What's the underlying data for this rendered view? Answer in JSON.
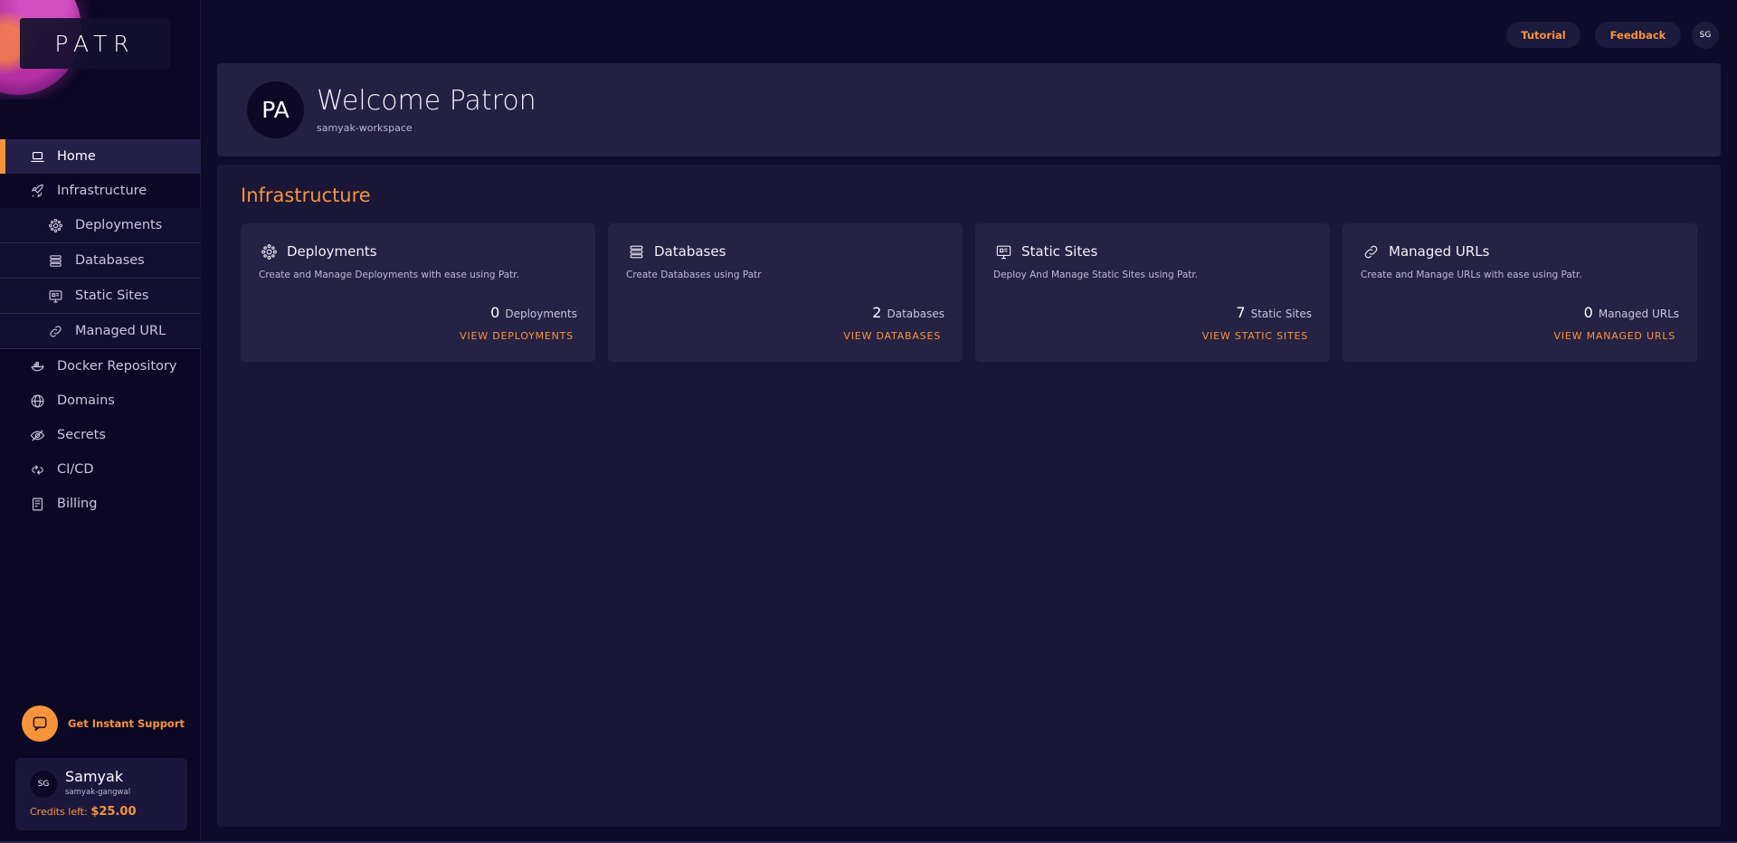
{
  "brand": {
    "logo_text": "PATR"
  },
  "sidebar": {
    "items": [
      {
        "label": "Home",
        "icon": "laptop-icon",
        "active": true
      },
      {
        "label": "Infrastructure",
        "icon": "rocket-icon"
      },
      {
        "label": "Deployments",
        "icon": "gear-cluster-icon",
        "sub": true
      },
      {
        "label": "Databases",
        "icon": "database-icon",
        "sub": true
      },
      {
        "label": "Static Sites",
        "icon": "monitor-icon",
        "sub": true
      },
      {
        "label": "Managed URL",
        "icon": "link-icon",
        "sub": true
      },
      {
        "label": "Docker Repository",
        "icon": "docker-icon"
      },
      {
        "label": "Domains",
        "icon": "globe-icon"
      },
      {
        "label": "Secrets",
        "icon": "eye-off-icon"
      },
      {
        "label": "CI/CD",
        "icon": "cicd-icon"
      },
      {
        "label": "Billing",
        "icon": "billing-icon"
      }
    ],
    "support_label": "Get Instant Support",
    "user": {
      "initials": "SG",
      "name": "Samyak",
      "handle": "samyak-gangwal",
      "credits_label": "Credits left:",
      "credits_value": "$25.00"
    }
  },
  "topbar": {
    "tutorial_label": "Tutorial",
    "feedback_label": "Feedback",
    "avatar_initials": "SG"
  },
  "welcome": {
    "avatar_initials": "PA",
    "title": "Welcome Patron",
    "workspace": "samyak-workspace"
  },
  "main": {
    "section_title": "Infrastructure",
    "cards": [
      {
        "title": "Deployments",
        "icon": "gear-cluster-icon",
        "description": "Create and Manage Deployments with ease using Patr.",
        "count": "0",
        "unit": "Deployments",
        "link": "VIEW DEPLOYMENTS"
      },
      {
        "title": "Databases",
        "icon": "database-icon",
        "description": "Create Databases using Patr",
        "count": "2",
        "unit": "Databases",
        "link": "VIEW DATABASES"
      },
      {
        "title": "Static Sites",
        "icon": "monitor-icon",
        "description": "Deploy And Manage Static Sites using Patr.",
        "count": "7",
        "unit": "Static Sites",
        "link": "VIEW STATIC SITES"
      },
      {
        "title": "Managed URLs",
        "icon": "link-icon",
        "description": "Create and Manage URLs with ease using Patr.",
        "count": "0",
        "unit": "Managed URLs",
        "link": "VIEW MANAGED URLS"
      }
    ]
  },
  "colors": {
    "accent": "#f7943b",
    "background": "#0e0a2a",
    "panel": "#1a1637",
    "card": "#252244"
  }
}
